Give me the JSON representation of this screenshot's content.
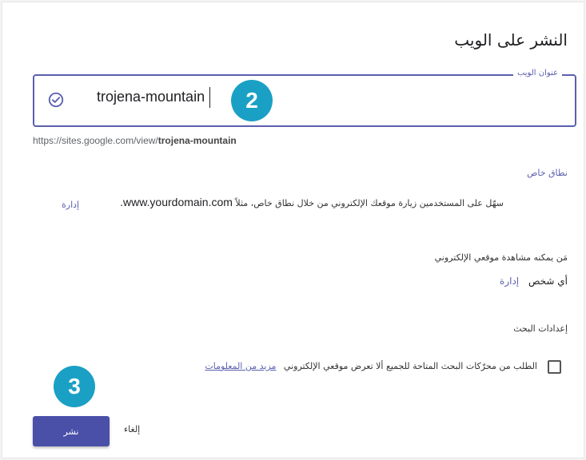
{
  "dialog": {
    "title": "النشر على الويب"
  },
  "url_field": {
    "label": "عنوان الويب",
    "value": "trojena-mountain"
  },
  "site_url": {
    "prefix": "https://sites.google.com/view/",
    "slug": "trojena-mountain"
  },
  "custom_domain": {
    "label": "نطاق خاص",
    "description": "سهّل على المستخدمين زيارة موقعك الإلكتروني من خلال نطاق خاص، مثلاً",
    "example": "www.yourdomain.com.",
    "manage_link": "إدارة"
  },
  "visibility": {
    "label": "مَن يمكنه مشاهدة موقعي الإلكتروني",
    "value": "أي شخص",
    "manage_link": "إدارة"
  },
  "search_settings": {
    "label": "إعدادات البحث",
    "checkbox_text": "الطلب من محرّكات البحث المتاحة للجميع ألا تعرض موقعي الإلكتروني",
    "checked": false,
    "more_info_link": "مزيد من المعلومات"
  },
  "buttons": {
    "publish": "نشر",
    "cancel": "إلغاء"
  },
  "annotations": {
    "step_2": "2",
    "step_3": "3"
  },
  "colors": {
    "accent": "#5b5fae",
    "publish_button": "#4a4fa8",
    "badge": "#1aa0c4"
  },
  "icons": {
    "field_status": "check-circle-icon"
  }
}
